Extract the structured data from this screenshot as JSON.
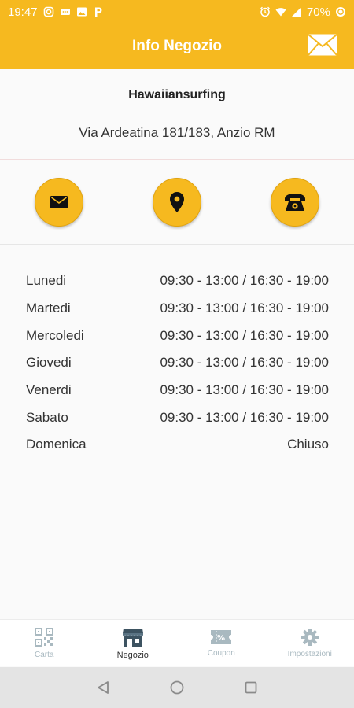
{
  "status_bar": {
    "time": "19:47",
    "battery": "70%"
  },
  "app_bar": {
    "title": "Info Negozio",
    "action_icon": "envelope-icon"
  },
  "shop": {
    "name": "Hawaiiansurfing",
    "address": "Via Ardeatina 181/183, Anzio RM"
  },
  "actions": [
    {
      "icon": "envelope-icon"
    },
    {
      "icon": "map-pin-icon"
    },
    {
      "icon": "telephone-icon"
    }
  ],
  "hours": [
    {
      "day": "Lunedi",
      "time": "09:30 - 13:00 / 16:30 - 19:00"
    },
    {
      "day": "Martedi",
      "time": "09:30 - 13:00 / 16:30 - 19:00"
    },
    {
      "day": "Mercoledi",
      "time": "09:30 - 13:00 / 16:30 - 19:00"
    },
    {
      "day": "Giovedi",
      "time": "09:30 - 13:00 / 16:30 - 19:00"
    },
    {
      "day": "Venerdi",
      "time": "09:30 - 13:00 / 16:30 - 19:00"
    },
    {
      "day": "Sabato",
      "time": "09:30 - 13:00 / 16:30 - 19:00"
    },
    {
      "day": "Domenica",
      "time": "Chiuso"
    }
  ],
  "bottom_nav": {
    "items": [
      {
        "label": "Carta",
        "icon": "qr-code-icon"
      },
      {
        "label": "Negozio",
        "icon": "store-icon",
        "active": true
      },
      {
        "label": "Coupon",
        "icon": "coupon-icon"
      },
      {
        "label": "Impostazioni",
        "icon": "gear-icon"
      }
    ]
  },
  "colors": {
    "accent": "#f6b91f",
    "nav_inactive": "#a9b9c0",
    "nav_active": "#333333"
  }
}
